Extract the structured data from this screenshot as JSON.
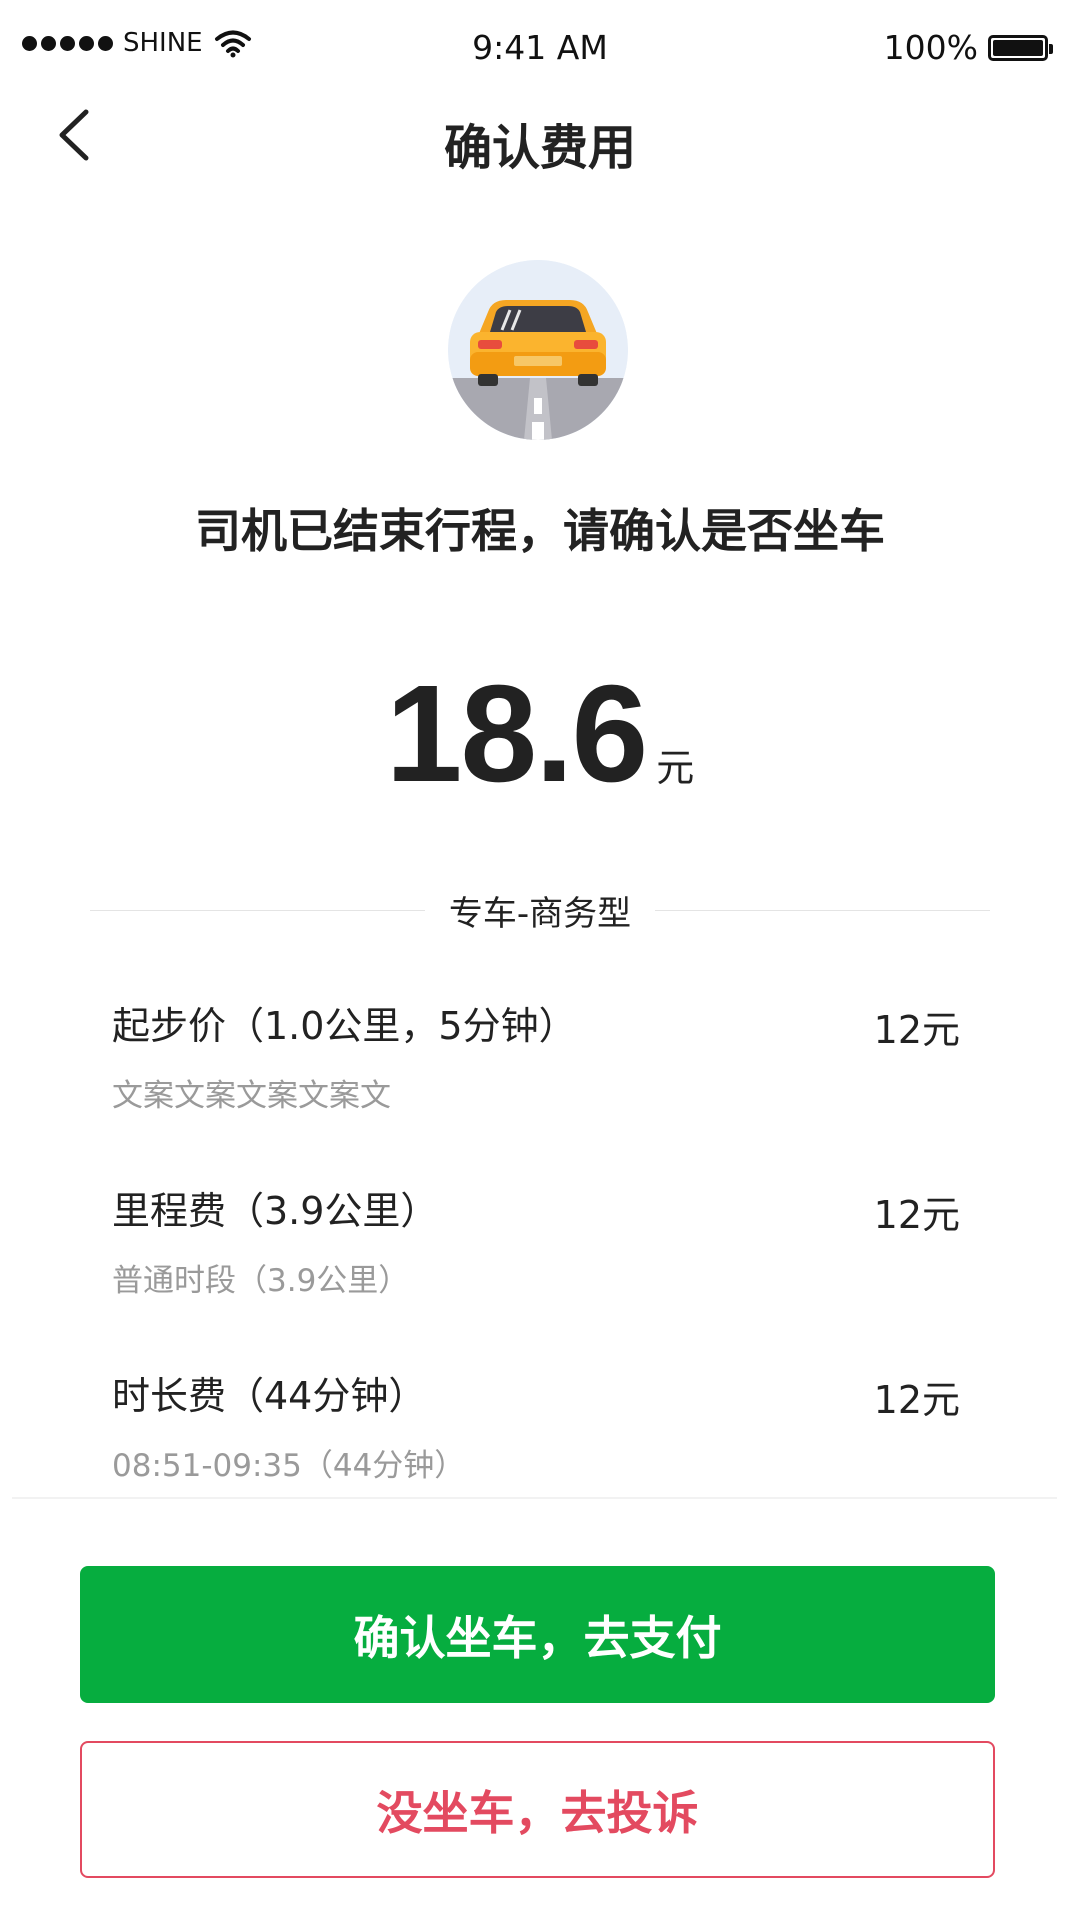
{
  "status_bar": {
    "carrier": "SHINE",
    "time": "9:41 AM",
    "battery_text": "100%",
    "signal_icon": "signal-dots-icon",
    "wifi_icon": "wifi-icon",
    "battery_icon": "battery-icon"
  },
  "nav": {
    "back_icon": "chevron-left-icon",
    "title": "确认费用"
  },
  "trip": {
    "car_icon": "car-icon",
    "message": "司机已结束行程，请确认是否坐车",
    "price": "18.6",
    "unit": "元",
    "service_type": "专车-商务型"
  },
  "fees": [
    {
      "title": "起步价（1.0公里，5分钟）",
      "amount": "12元",
      "detail": "文案文案文案文案文"
    },
    {
      "title": "里程费（3.9公里）",
      "amount": "12元",
      "detail": "普通时段（3.9公里）"
    },
    {
      "title": "时长费（44分钟）",
      "amount": "12元",
      "detail": "08:51-09:35（44分钟）"
    }
  ],
  "actions": {
    "confirm": "确认坐车，去支付",
    "complain": "没坐车，去投诉"
  },
  "colors": {
    "primary_green": "#06ad3f",
    "complain_red": "#e34a60",
    "secondary_text": "#9a9a9a"
  }
}
